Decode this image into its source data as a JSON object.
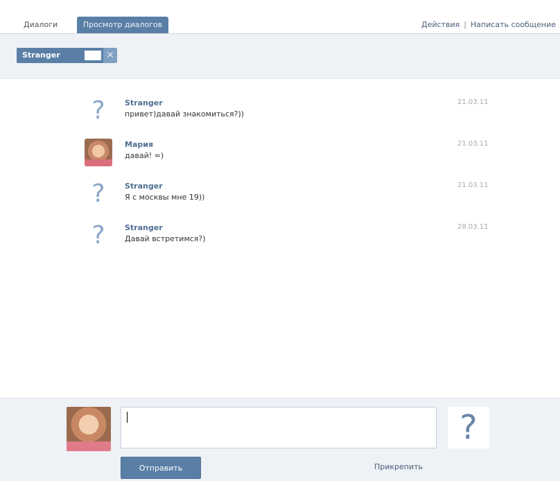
{
  "tabs": {
    "dialogs": "Диалоги",
    "view": "Просмотр диалогов"
  },
  "top_actions": {
    "actions": "Действия",
    "separator": "|",
    "write": "Написать сообщение"
  },
  "filter": {
    "chip_label": "Stranger",
    "close_glyph": "✕"
  },
  "messages": [
    {
      "name": "Stranger",
      "text": "привет)давай знакомиться?))",
      "date": "21.03.11",
      "avatar": "question"
    },
    {
      "name": "Мария",
      "text": "давай! =)",
      "date": "21.03.11",
      "avatar": "photo"
    },
    {
      "name": "Stranger",
      "text": "Я с москвы мне 19))",
      "date": "21.03.11",
      "avatar": "question"
    },
    {
      "name": "Stranger",
      "text": "Давай встретимся?)",
      "date": "28.03.11",
      "avatar": "question"
    }
  ],
  "composer": {
    "input_value": "",
    "send_label": "Отправить",
    "attach_label": "Прикрепить",
    "partner_glyph": "?"
  },
  "icons": {
    "question": "?"
  }
}
